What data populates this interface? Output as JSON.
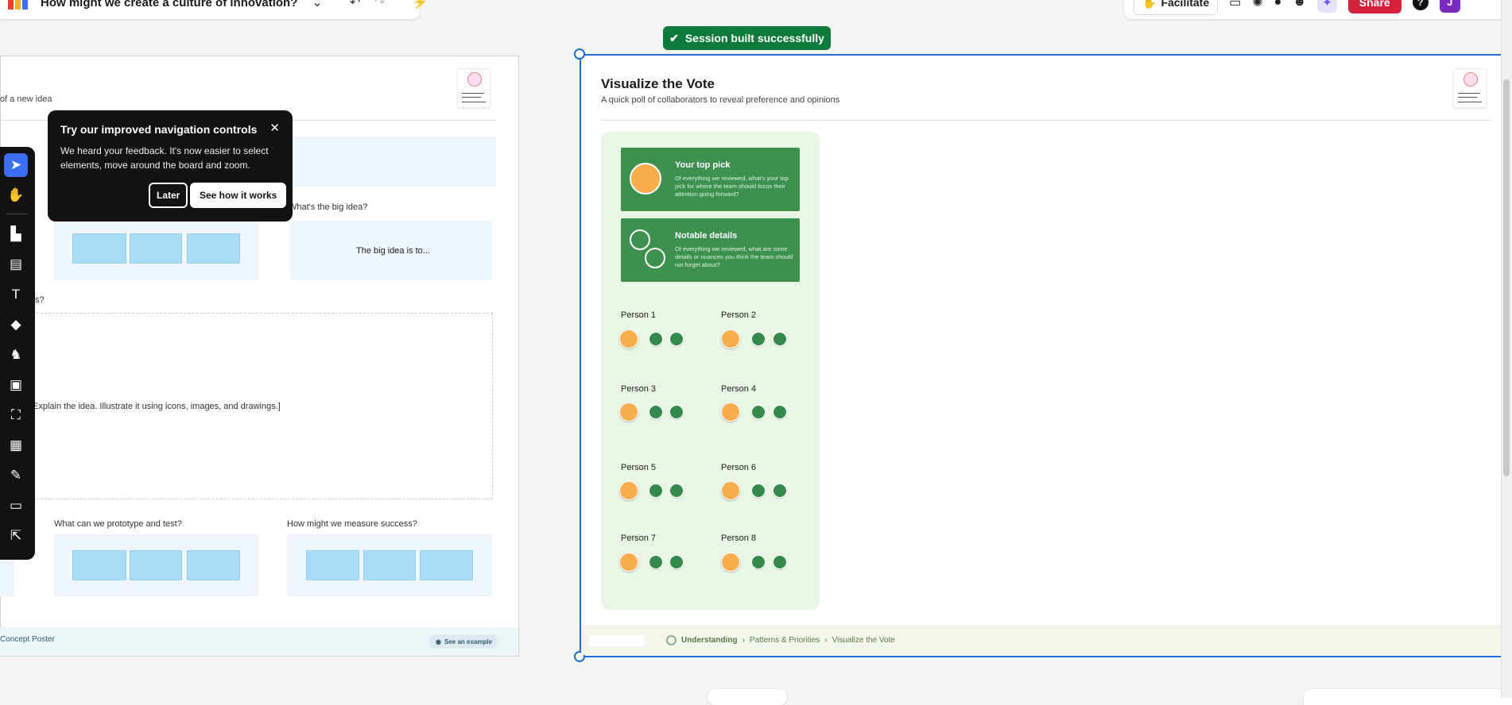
{
  "topbar": {
    "board_title": "How might we create a culture of innovation?",
    "facilitate_label": "Facilitate",
    "share_label": "Share",
    "help_label": "?",
    "avatar_initial": "J"
  },
  "toast": {
    "label": "Session built successfully"
  },
  "left_frame": {
    "subtitle": "of a new idea",
    "q_big_idea": "What's the big idea?",
    "big_idea_text": "The big idea is to...",
    "q_partial": "ts?",
    "explain_text": "Explain the idea. Illustrate it using icons, images, and drawings.]",
    "q_prototype": "What can we prototype and test?",
    "q_measure": "How might we measure success?",
    "footer_label": "Concept Poster",
    "see_example": "See an example"
  },
  "tooltip": {
    "title": "Try our improved navigation controls",
    "body": "We heard your feedback. It's now easier to select elements, move around the board and zoom.",
    "later": "Later",
    "how": "See how it works"
  },
  "toolbar": {
    "tools": [
      "select-tool",
      "hand-tool",
      "templates-tool",
      "sticky-note-tool",
      "text-tool",
      "shapes-tool",
      "icons-tool",
      "image-tool",
      "diagram-tool",
      "table-tool",
      "pen-tool",
      "archive-tool",
      "export-tool"
    ]
  },
  "right_frame": {
    "title": "Visualize the Vote",
    "subtitle": "A quick poll of collaborators to reveal preference and opinions",
    "card1_title": "Your top pick",
    "card1_body": "Of everything we reviewed, what's your top pick for where the team should focus their attention going forward?",
    "card2_title": "Notable details",
    "card2_body": "Of everything we reviewed, what are some details or nuances you think the team should not forget about?",
    "persons": [
      "Person 1",
      "Person 2",
      "Person 3",
      "Person 4",
      "Person 5",
      "Person 6",
      "Person 7",
      "Person 8"
    ],
    "crumbs": [
      "Understanding",
      "Patterns & Priorities",
      "Visualize the Vote"
    ]
  },
  "colors": {
    "accent": "#1e6fd1",
    "toast": "#0b7a3b",
    "share": "#d4213d",
    "card_green": "#3c914f",
    "dot_orange": "#f9ad4c",
    "dot_green": "#338a4c"
  }
}
